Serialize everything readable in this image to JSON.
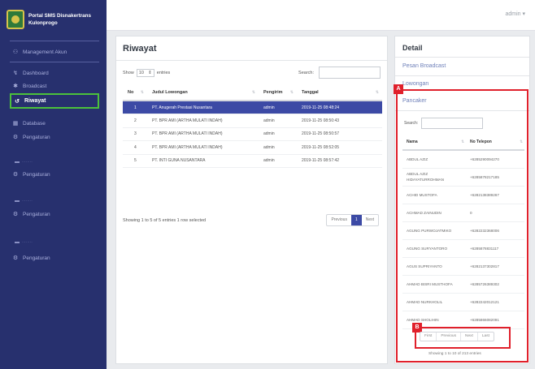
{
  "app": {
    "title": "Portal SMS Disnakertrans Kulonprogo",
    "user": "admin"
  },
  "sidebar": {
    "items": [
      {
        "label": "Management Akun",
        "icon": "users-icon"
      },
      {
        "label": "Dashboard",
        "icon": "chart-icon"
      },
      {
        "label": "Broadcast",
        "icon": "broadcast-icon"
      },
      {
        "label": "Riwayat",
        "icon": "history-icon"
      },
      {
        "label": "Database",
        "icon": "database-icon"
      },
      {
        "label": "Pengaturan",
        "icon": "gear-icon"
      }
    ],
    "section_items": [
      {
        "heading": "—",
        "label": "Pengaturan"
      },
      {
        "heading": "—",
        "label": "Pengaturan"
      },
      {
        "heading": "—",
        "label": "Pengaturan"
      }
    ]
  },
  "riwayat": {
    "title": "Riwayat",
    "show_label": "Show",
    "entries_value": "10",
    "entries_label": "entries",
    "search_label": "Search:",
    "columns": [
      "No",
      "Judul Lowongan",
      "Pengirim",
      "Tanggal"
    ],
    "rows": [
      {
        "no": "1",
        "judul": "PT. Anugerah Prestasi Nusantara",
        "pengirim": "admin",
        "tanggal": "2019-11-25 08:48:24"
      },
      {
        "no": "2",
        "judul": "PT. BPR AMI (ARTHA MULATI INDAH)",
        "pengirim": "admin",
        "tanggal": "2019-11-25 08:50:43"
      },
      {
        "no": "3",
        "judul": "PT. BPR AMI (ARTHA MULATI INDAH)",
        "pengirim": "admin",
        "tanggal": "2019-11-25 08:50:57"
      },
      {
        "no": "4",
        "judul": "PT. BPR AMI (ARTHA MULATI INDAH)",
        "pengirim": "admin",
        "tanggal": "2019-11-25 08:52:05"
      },
      {
        "no": "5",
        "judul": "PT. INTI GUNA NUSANTARA",
        "pengirim": "admin",
        "tanggal": "2019-11-25 08:57:42"
      }
    ],
    "info": "Showing 1 to 5 of 5 entries   1 row selected",
    "pager": {
      "previous": "Previous",
      "current": "1",
      "next": "Next"
    }
  },
  "detail": {
    "title": "Detail",
    "links": [
      "Pesan Broadcast",
      "Lowongan",
      "Pancaker"
    ],
    "search_label": "Search:",
    "columns": [
      "Nama",
      "No Telepon"
    ],
    "rows": [
      {
        "nama": "ABDUL AZIZ",
        "telp": "+6285290094270"
      },
      {
        "nama": "ABDUL AZIZ HIDAYATURROHMAN",
        "telp": "+6285878217185"
      },
      {
        "nama": "ACHID MUSTOFA",
        "telp": "+6282138389267"
      },
      {
        "nama": "ACHMAD ZAINUDIN",
        "telp": "0"
      },
      {
        "nama": "AGUNG PURWOJATMIKO",
        "telp": "+6282232368006"
      },
      {
        "nama": "AGUNG SURYANTORO",
        "telp": "+6285878831117"
      },
      {
        "nama": "AGUS SUPRIYANTO",
        "telp": "+6282137302817"
      },
      {
        "nama": "AHMAD BISRI MUSTHOFA",
        "telp": "+6285726389302"
      },
      {
        "nama": "AHMAD NURKHOLIL",
        "telp": "+6282242012121"
      },
      {
        "nama": "AHMAD SHOLIHIN",
        "telp": "+6285866082091"
      }
    ],
    "pager": [
      "First",
      "Previous",
      "Next",
      "Last"
    ],
    "info": "Showing 1 to 10 of 213 entries"
  },
  "annotations": {
    "a": "A",
    "b": "B"
  },
  "colors": {
    "sidebar": "#27306e",
    "selected_row": "#3c4aa5",
    "highlight_green": "#4cc13b",
    "annotation_red": "#e0202b"
  }
}
